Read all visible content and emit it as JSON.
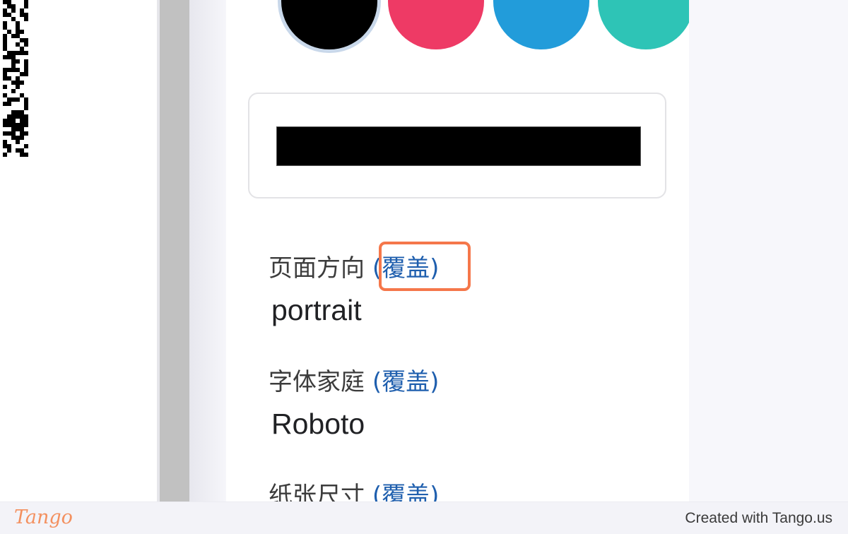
{
  "swatches": [
    {
      "name": "black",
      "color": "#000000",
      "selected": true
    },
    {
      "name": "red",
      "color": "#ee3a65",
      "selected": false
    },
    {
      "name": "blue",
      "color": "#229cda",
      "selected": false
    },
    {
      "name": "teal",
      "color": "#2ec4b6",
      "selected": false
    }
  ],
  "preview": {
    "bar_color": "#000000"
  },
  "settings": [
    {
      "label": "页面方向",
      "override": "(覆盖)",
      "value": "portrait"
    },
    {
      "label": "字体家庭",
      "override": "(覆盖)",
      "value": "Roboto"
    },
    {
      "label": "纸张尺寸",
      "override": "(覆盖)",
      "value": ""
    }
  ],
  "highlight": {
    "color": "#f5774a"
  },
  "footer": {
    "logo": "Tango",
    "credit": "Created with Tango.us"
  }
}
